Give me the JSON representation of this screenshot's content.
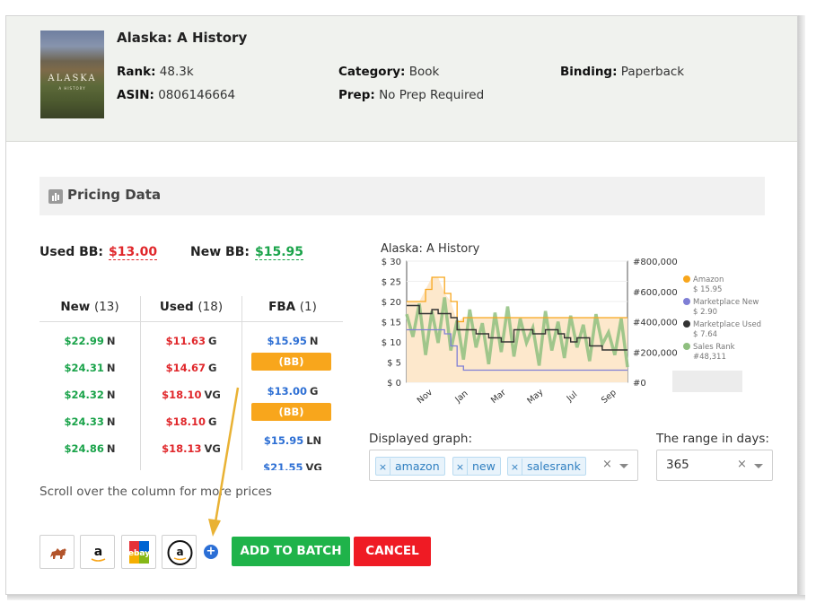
{
  "book": {
    "cover_title": "ALASKA",
    "cover_subtitle": "A HISTORY",
    "title": "Alaska: A History",
    "rank_label": "Rank:",
    "rank": "48.3k",
    "asin_label": "ASIN:",
    "asin": "0806146664",
    "category_label": "Category:",
    "category": "Book",
    "prep_label": "Prep:",
    "prep": "No Prep Required",
    "binding_label": "Binding:",
    "binding": "Paperback"
  },
  "pricing": {
    "section_title": "Pricing Data",
    "used_bb_label": "Used BB:",
    "used_bb": "$13.00",
    "new_bb_label": "New BB:",
    "new_bb": "$15.95",
    "columns": [
      {
        "name": "New",
        "count": "(13)",
        "rows": [
          {
            "price": "$22.99",
            "cond": "N"
          },
          {
            "price": "$24.31",
            "cond": "N"
          },
          {
            "price": "$24.32",
            "cond": "N"
          },
          {
            "price": "$24.33",
            "cond": "N"
          },
          {
            "price": "$24.86",
            "cond": "N"
          }
        ]
      },
      {
        "name": "Used",
        "count": "(18)",
        "rows": [
          {
            "price": "$11.63",
            "cond": "G"
          },
          {
            "price": "$14.67",
            "cond": "G"
          },
          {
            "price": "$18.10",
            "cond": "VG"
          },
          {
            "price": "$18.10",
            "cond": "G"
          },
          {
            "price": "$18.13",
            "cond": "VG"
          }
        ]
      },
      {
        "name": "FBA",
        "count": "(1)",
        "rows": [
          {
            "price": "$15.95",
            "cond": "N",
            "badge": "(BB)"
          },
          {
            "price": "$13.00",
            "cond": "G",
            "badge": "(BB)"
          },
          {
            "price": "$15.95",
            "cond": "LN"
          },
          {
            "price": "$21.55",
            "cond": "VG"
          }
        ]
      }
    ],
    "scroll_hint": "Scroll over the column for more prices"
  },
  "actions": {
    "stores": [
      {
        "name": "camel-store-icon"
      },
      {
        "name": "amazon-icon",
        "glyph": "a"
      },
      {
        "name": "ebay-icon",
        "glyph": "ebay"
      },
      {
        "name": "amazon-circle-icon",
        "glyph": "a"
      }
    ],
    "plus": "+",
    "add_to_batch": "ADD TO BATCH",
    "cancel": "CANCEL",
    "colors": {
      "add": "#1fb34a",
      "cancel": "#ef1b24"
    }
  },
  "graph_controls": {
    "displayed_label": "Displayed graph:",
    "tags": [
      "amazon",
      "new",
      "salesrank"
    ],
    "range_label": "The range in days:",
    "range_value": "365"
  },
  "chart_data": {
    "type": "line",
    "title": "Alaska: A History",
    "x_ticks": [
      "Nov",
      "Jan",
      "Mar",
      "May",
      "Jul",
      "Sep"
    ],
    "y_left_ticks": [
      "$ 30",
      "$ 25",
      "$ 20",
      "$ 15",
      "$ 10",
      "$ 5",
      "$ 0"
    ],
    "y_right_ticks": [
      "#800,000",
      "#600,000",
      "#400,000",
      "#200,000",
      "#0"
    ],
    "ylim_left": [
      0,
      30
    ],
    "ylim_right": [
      0,
      800000
    ],
    "legend_position": "right",
    "series": [
      {
        "name": "Amazon",
        "color": "#f8a61c",
        "current": "$ 15.95",
        "values": [
          20,
          20,
          20,
          23,
          26,
          26,
          22,
          20,
          15,
          16,
          16,
          16,
          16,
          16,
          16,
          16,
          16,
          16,
          16,
          16,
          16,
          16,
          16,
          16,
          16,
          16,
          16,
          16,
          16,
          16,
          16,
          16,
          16,
          16,
          16,
          16
        ]
      },
      {
        "name": "Marketplace New",
        "color": "#7f7fd5",
        "current": "$ 2.90",
        "values": [
          13,
          13,
          13,
          13,
          13,
          13,
          12,
          9,
          4,
          3,
          3,
          3,
          3,
          3,
          3,
          3,
          3,
          3,
          3,
          3,
          3,
          3,
          3,
          3,
          3,
          3,
          3,
          3,
          3,
          3,
          3,
          3,
          3,
          3,
          3,
          3
        ]
      },
      {
        "name": "Marketplace Used",
        "color": "#333333",
        "current": "$ 7.64",
        "values": [
          19,
          19,
          17,
          17,
          18,
          17,
          17,
          16,
          13,
          13,
          13,
          12,
          12,
          11,
          11,
          10,
          10,
          13,
          13,
          13,
          12,
          12,
          13,
          13,
          12,
          11,
          10,
          11,
          11,
          9,
          9,
          8,
          8,
          8,
          8,
          8
        ]
      },
      {
        "name": "Sales Rank",
        "color": "#8fbf7f",
        "current": "#48,311",
        "values": [
          450000,
          300000,
          520000,
          180000,
          470000,
          260000,
          560000,
          210000,
          410000,
          150000,
          480000,
          230000,
          390000,
          120000,
          460000,
          200000,
          500000,
          170000,
          420000,
          260000,
          360000,
          110000,
          470000,
          210000,
          400000,
          160000,
          440000,
          230000,
          380000,
          140000,
          450000,
          250000,
          330000,
          180000,
          420000,
          100000
        ]
      }
    ]
  }
}
